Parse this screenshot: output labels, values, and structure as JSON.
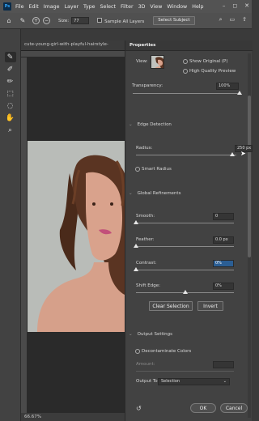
{
  "menubar": {
    "logo": "Ps",
    "items": [
      "File",
      "Edit",
      "Image",
      "Layer",
      "Type",
      "Select",
      "Filter",
      "3D",
      "View",
      "Window",
      "Help"
    ],
    "controls": [
      "–",
      "◻",
      "✕"
    ]
  },
  "options": {
    "size_label": "Size:",
    "size_value": "77",
    "sample_all_layers": "Sample All Layers",
    "select_subject": "Select Subject"
  },
  "document": {
    "tab_title": "cute-young-girl-with-playful-hairstyle-",
    "zoom": "66.67%"
  },
  "properties": {
    "tab_title": "Properties",
    "view_label": "View:",
    "show_original": "Show Original (P)",
    "high_quality_preview": "High Quality Preview",
    "transparency_label": "Transparency:",
    "transparency_value": "100%",
    "transparency_level": 1.0,
    "edge_detection": {
      "header": "Edge Detection",
      "radius_label": "Radius:",
      "radius_value": "250 px",
      "radius_level": 0.96,
      "smart_radius": "Smart Radius"
    },
    "global_refinements": {
      "header": "Global Refinements",
      "smooth_label": "Smooth:",
      "smooth_value": "0",
      "smooth_level": 0,
      "feather_label": "Feather:",
      "feather_value": "0.0 px",
      "feather_level": 0,
      "contrast_label": "Contrast:",
      "contrast_value": "0%",
      "contrast_level": 0,
      "shift_edge_label": "Shift Edge:",
      "shift_edge_value": "0%",
      "shift_edge_level": 0.5
    },
    "clear_selection": "Clear Selection",
    "invert": "Invert",
    "output_settings": {
      "header": "Output Settings",
      "decontaminate": "Decontaminate Colors",
      "amount_label": "Amount:",
      "output_to_label": "Output To:",
      "output_to_value": "Selection"
    },
    "ok": "OK",
    "cancel": "Cancel"
  }
}
